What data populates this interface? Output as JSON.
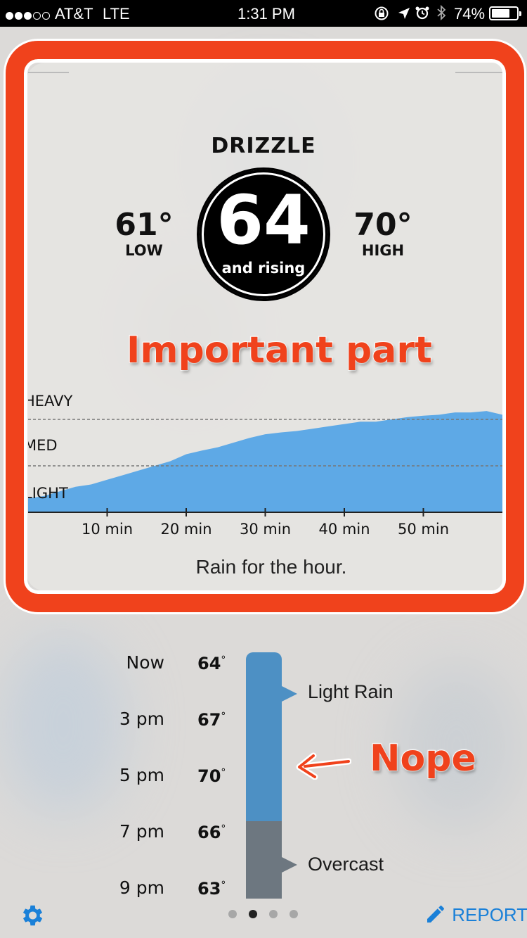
{
  "status_bar": {
    "carrier": "AT&T",
    "network": "LTE",
    "time": "1:31 PM",
    "battery": "74%",
    "signal_bars_filled": 3,
    "signal_bars_total": 5,
    "battery_level": 0.74
  },
  "current": {
    "condition": "DRIZZLE",
    "temperature": "64",
    "trend": "and rising",
    "low_value": "61°",
    "low_label": "LOW",
    "high_value": "70°",
    "high_label": "HIGH"
  },
  "annotations": {
    "important": "Important part",
    "nope": "Nope",
    "color": "#f0421c"
  },
  "chart_data": {
    "type": "area",
    "title": "",
    "xlabel": "",
    "ylabel": "",
    "x_tick_labels": [
      "10 min",
      "20 min",
      "30 min",
      "40 min",
      "50 min"
    ],
    "x_ticks": [
      10,
      20,
      30,
      40,
      50
    ],
    "y_levels": [
      "LIGHT",
      "MED",
      "HEAVY"
    ],
    "y_level_values": [
      1,
      2,
      3
    ],
    "xlim": [
      0,
      60
    ],
    "ylim": [
      0,
      3
    ],
    "grid_lines_at": [
      1,
      2
    ],
    "color": "#5ea9e6",
    "series": [
      {
        "x": [
          0,
          2,
          4,
          6,
          8,
          10,
          12,
          14,
          16,
          18,
          20,
          22,
          24,
          26,
          28,
          30,
          32,
          34,
          36,
          38,
          40,
          42,
          44,
          46,
          48,
          50,
          52,
          54,
          56,
          58,
          60
        ],
        "values": [
          0.3,
          0.35,
          0.45,
          0.55,
          0.6,
          0.7,
          0.8,
          0.9,
          1.0,
          1.1,
          1.25,
          1.33,
          1.4,
          1.5,
          1.6,
          1.68,
          1.72,
          1.75,
          1.8,
          1.85,
          1.9,
          1.95,
          1.95,
          2.0,
          2.05,
          2.08,
          2.1,
          2.15,
          2.15,
          2.18,
          2.1
        ]
      }
    ],
    "caption": "Rain for the hour."
  },
  "forecast": {
    "rows": [
      {
        "time": "Now",
        "temp": "64",
        "deg": "°"
      },
      {
        "time": "3 pm",
        "temp": "67",
        "deg": "°"
      },
      {
        "time": "5 pm",
        "temp": "70",
        "deg": "°"
      },
      {
        "time": "7 pm",
        "temp": "66",
        "deg": "°"
      },
      {
        "time": "9 pm",
        "temp": "63",
        "deg": "°"
      }
    ],
    "conditions": [
      "Light Rain",
      "Overcast"
    ],
    "rain_color": "#4d90c4",
    "overcast_color": "#6d7780"
  },
  "pager": {
    "count": 4,
    "active_index": 1
  },
  "toolbar": {
    "settings_icon": "gear-icon",
    "report_label": "REPORT",
    "report_icon": "pencil-icon",
    "accent": "#1a80d8"
  }
}
